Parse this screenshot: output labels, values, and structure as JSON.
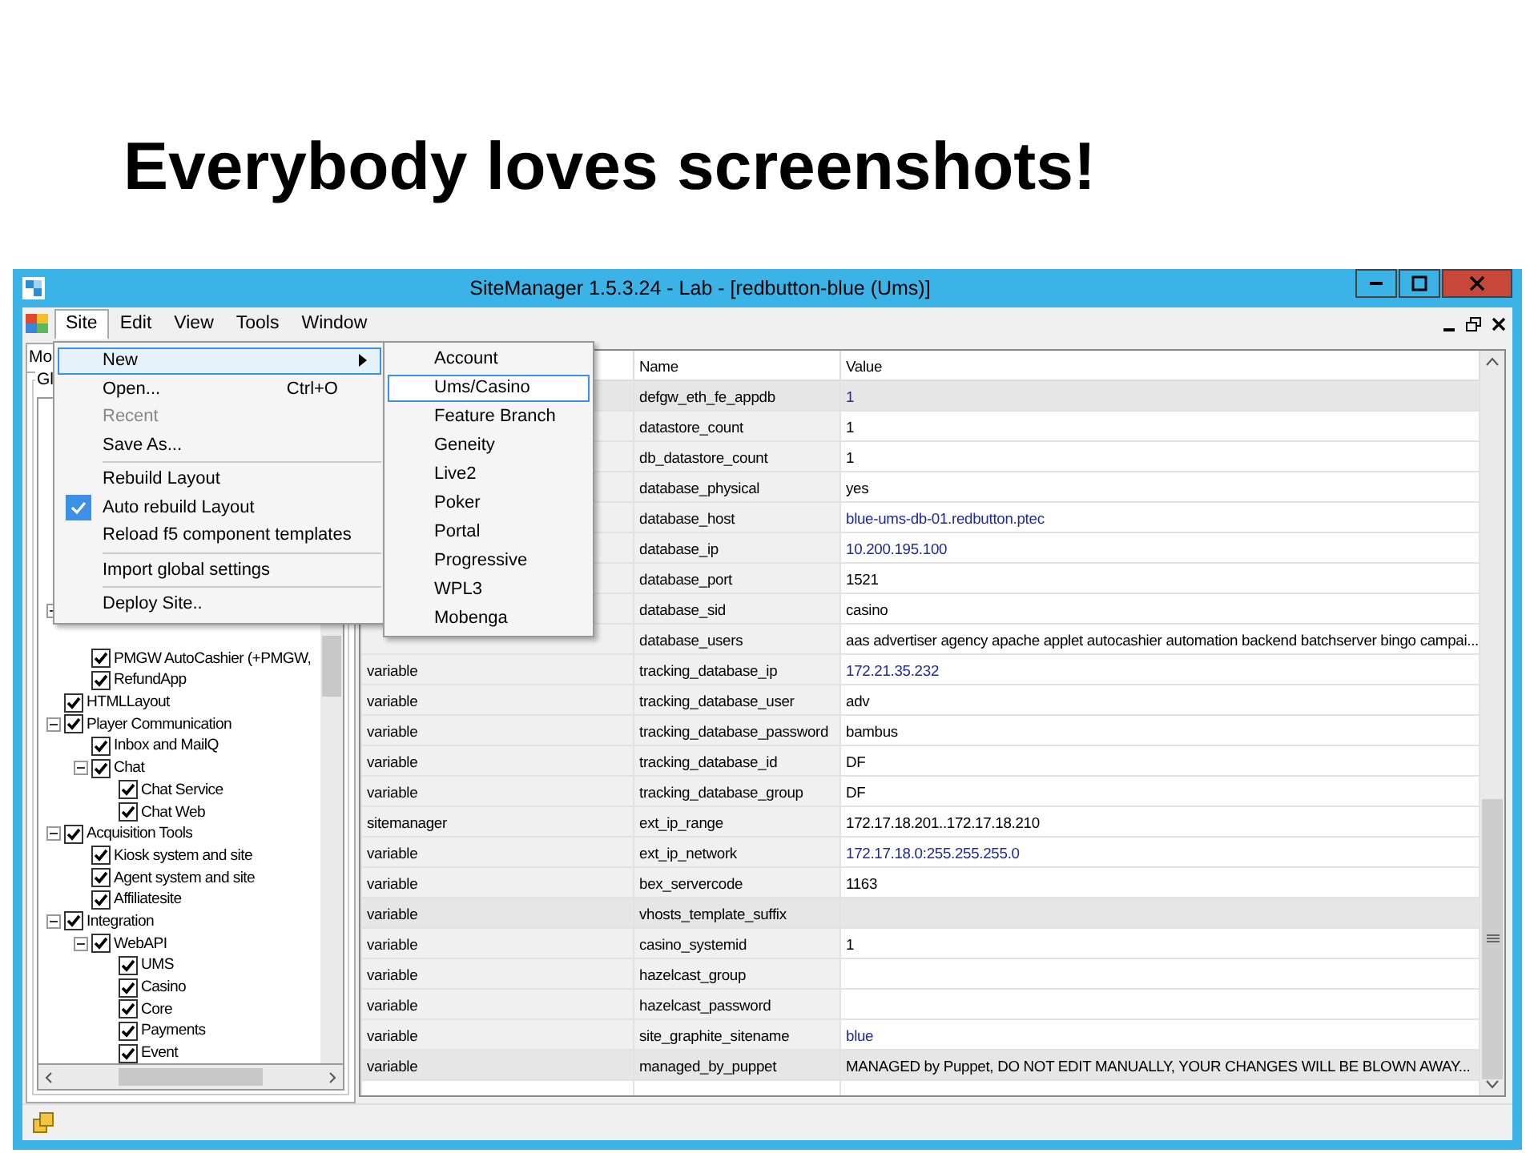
{
  "slide_title": "Everybody loves screenshots!",
  "window": {
    "title": "SiteManager 1.5.3.24 - Lab - [redbutton-blue (Ums)]"
  },
  "menubar": [
    {
      "label": "Site",
      "selected": true
    },
    {
      "label": "Edit",
      "selected": false
    },
    {
      "label": "View",
      "selected": false
    },
    {
      "label": "Tools",
      "selected": false
    },
    {
      "label": "Window",
      "selected": false
    }
  ],
  "left_panel": {
    "tab": "Mo",
    "group": "Gl"
  },
  "tree": [
    {
      "expanded": true,
      "children": [
        {
          "label": "PMGW AutoCashier (+PMGW,",
          "checked": true
        },
        {
          "label": "RefundApp",
          "checked": true
        }
      ]
    },
    {
      "label": "HTMLLayout",
      "checked": true
    },
    {
      "label": "Player Communication",
      "checked": true,
      "expanded": true,
      "children": [
        {
          "label": "Inbox and MailQ",
          "checked": true
        },
        {
          "label": "Chat",
          "checked": true,
          "expanded": true,
          "children": [
            {
              "label": "Chat Service",
              "checked": true
            },
            {
              "label": "Chat Web",
              "checked": true
            }
          ]
        }
      ]
    },
    {
      "label": "Acquisition Tools",
      "checked": true,
      "expanded": true,
      "children": [
        {
          "label": "Kiosk system and site",
          "checked": true
        },
        {
          "label": "Agent system and site",
          "checked": true
        },
        {
          "label": "Affiliatesite",
          "checked": true
        }
      ]
    },
    {
      "label": "Integration",
      "checked": true,
      "expanded": true,
      "children": [
        {
          "label": "WebAPI",
          "checked": true,
          "expanded": true,
          "children": [
            {
              "label": "UMS",
              "checked": true
            },
            {
              "label": "Casino",
              "checked": true
            },
            {
              "label": "Core",
              "checked": true
            },
            {
              "label": "Payments",
              "checked": true
            },
            {
              "label": "Event",
              "checked": true
            }
          ]
        }
      ]
    }
  ],
  "site_menu": [
    {
      "kind": "item",
      "label": "New",
      "submenu": true,
      "selected": true,
      "checked": false,
      "disabled": false
    },
    {
      "kind": "item",
      "label": "Open...",
      "shortcut": "Ctrl+O",
      "selected": false,
      "checked": false,
      "disabled": false
    },
    {
      "kind": "item",
      "label": "Recent",
      "selected": false,
      "checked": false,
      "disabled": true
    },
    {
      "kind": "item",
      "label": "Save As...",
      "selected": false,
      "checked": false,
      "disabled": false
    },
    {
      "kind": "separator"
    },
    {
      "kind": "item",
      "label": "Rebuild Layout",
      "selected": false,
      "checked": false,
      "disabled": false
    },
    {
      "kind": "item",
      "label": "Auto rebuild Layout",
      "selected": false,
      "checked": true,
      "disabled": false
    },
    {
      "kind": "item",
      "label": "Reload f5 component templates",
      "selected": false,
      "checked": false,
      "disabled": false
    },
    {
      "kind": "separator"
    },
    {
      "kind": "item",
      "label": "Import global settings",
      "selected": false,
      "checked": false,
      "disabled": false
    },
    {
      "kind": "separator"
    },
    {
      "kind": "item",
      "label": "Deploy Site..",
      "selected": false,
      "checked": false,
      "disabled": false
    }
  ],
  "new_submenu": [
    {
      "label": "Account",
      "selected": false
    },
    {
      "label": "Ums/Casino",
      "selected": true
    },
    {
      "label": "Feature Branch",
      "selected": false
    },
    {
      "label": "Geneity",
      "selected": false
    },
    {
      "label": "Live2",
      "selected": false
    },
    {
      "label": "Poker",
      "selected": false
    },
    {
      "label": "Portal",
      "selected": false
    },
    {
      "label": "Progressive",
      "selected": false
    },
    {
      "label": "WPL3",
      "selected": false
    },
    {
      "label": "Mobenga",
      "selected": false
    }
  ],
  "table": {
    "columns": [
      "Name",
      "Value"
    ],
    "rows": [
      {
        "name": "defgw_eth_fe_appdb",
        "value": "1",
        "linked": true,
        "highlighted": true
      },
      {
        "name": "datastore_count",
        "value": "1",
        "linked": false,
        "highlighted": false
      },
      {
        "name": "db_datastore_count",
        "value": "1",
        "linked": false,
        "highlighted": false
      },
      {
        "name": "database_physical",
        "value": "yes",
        "linked": false,
        "highlighted": false
      },
      {
        "name": "database_host",
        "value": "blue-ums-db-01.redbutton.ptec",
        "linked": true,
        "highlighted": false
      },
      {
        "name": "database_ip",
        "value": "10.200.195.100",
        "linked": true,
        "highlighted": false
      },
      {
        "name": "database_port",
        "value": "1521",
        "linked": false,
        "highlighted": false
      },
      {
        "name": "database_sid",
        "value": "casino",
        "linked": false,
        "highlighted": false
      },
      {
        "name": "database_users",
        "value": "aas advertiser agency apache applet autocashier automation backend batchserver bingo campai...",
        "linked": false,
        "highlighted": false
      },
      {
        "type": "variable",
        "name": "tracking_database_ip",
        "value": "172.21.35.232",
        "linked": true,
        "highlighted": false
      },
      {
        "type": "variable",
        "name": "tracking_database_user",
        "value": "adv",
        "linked": false,
        "highlighted": false
      },
      {
        "type": "variable",
        "name": "tracking_database_password",
        "value": "bambus",
        "linked": false,
        "highlighted": false
      },
      {
        "type": "variable",
        "name": "tracking_database_id",
        "value": "DF",
        "linked": false,
        "highlighted": false
      },
      {
        "type": "variable",
        "name": "tracking_database_group",
        "value": "DF",
        "linked": false,
        "highlighted": false
      },
      {
        "type": "sitemanager",
        "name": "ext_ip_range",
        "value": "172.17.18.201..172.17.18.210",
        "linked": false,
        "highlighted": false
      },
      {
        "type": "variable",
        "name": "ext_ip_network",
        "value": "172.17.18.0:255.255.255.0",
        "linked": true,
        "highlighted": false
      },
      {
        "type": "variable",
        "name": "bex_servercode",
        "value": "1163",
        "linked": false,
        "highlighted": false
      },
      {
        "type": "variable",
        "name": "vhosts_template_suffix",
        "highlighted": true
      },
      {
        "type": "variable",
        "name": "casino_systemid",
        "value": "1",
        "linked": false,
        "highlighted": false
      },
      {
        "type": "variable",
        "name": "hazelcast_group",
        "highlighted": false
      },
      {
        "type": "variable",
        "name": "hazelcast_password",
        "highlighted": false
      },
      {
        "type": "variable",
        "name": "site_graphite_sitename",
        "value": "blue",
        "linked": true,
        "highlighted": false
      },
      {
        "type": "variable",
        "name": "managed_by_puppet",
        "value": "MANAGED by Puppet, DO NOT EDIT MANUALLY, YOUR CHANGES WILL BE BLOWN AWAY...",
        "linked": false,
        "highlighted": true
      }
    ]
  }
}
